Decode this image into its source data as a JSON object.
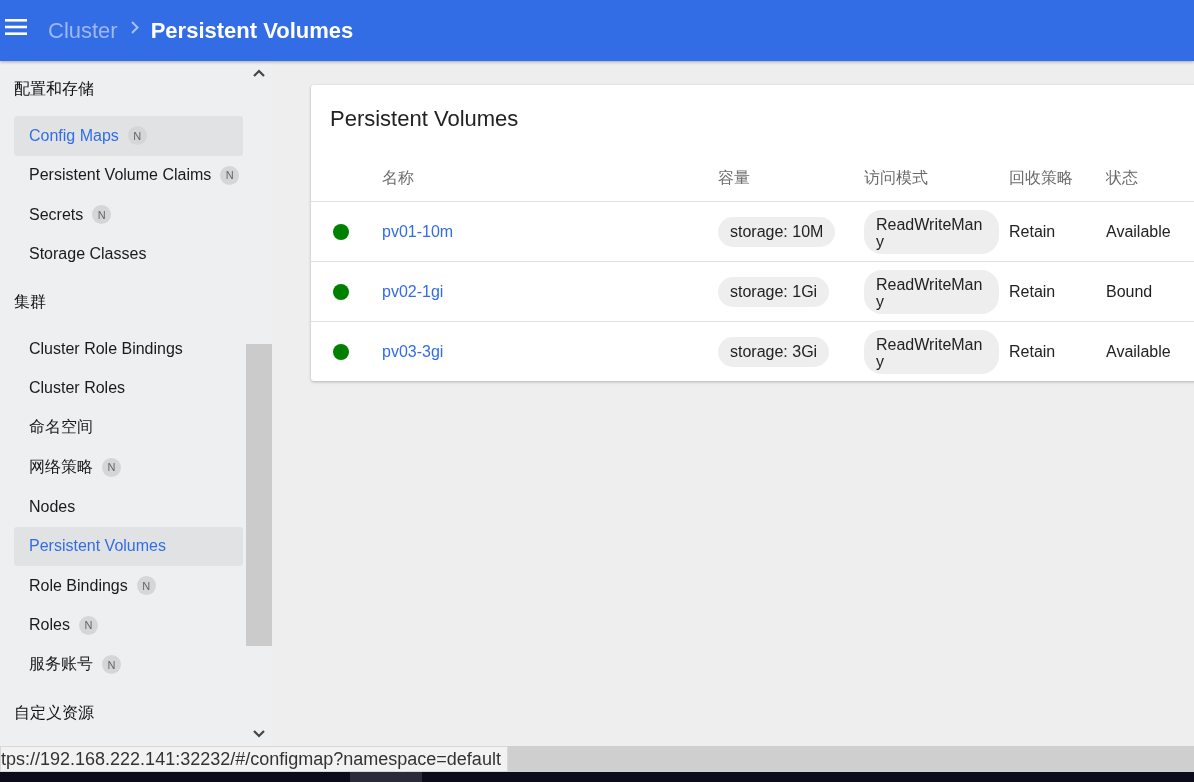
{
  "header": {
    "breadcrumbs": [
      {
        "label": "Cluster",
        "current": false
      },
      {
        "label": "Persistent Volumes",
        "current": true
      }
    ]
  },
  "sidebar": {
    "sections": [
      {
        "title": "配置和存储",
        "items": [
          {
            "label": "Config Maps",
            "badge": "N",
            "selected": true
          },
          {
            "label": "Persistent Volume Claims",
            "badge": "N",
            "selected": false
          },
          {
            "label": "Secrets",
            "badge": "N",
            "selected": false
          },
          {
            "label": "Storage Classes",
            "selected": false
          }
        ]
      },
      {
        "title": "集群",
        "items": [
          {
            "label": "Cluster Role Bindings",
            "selected": false
          },
          {
            "label": "Cluster Roles",
            "selected": false
          },
          {
            "label": "命名空间",
            "selected": false
          },
          {
            "label": "网络策略",
            "badge": "N",
            "selected": false
          },
          {
            "label": "Nodes",
            "selected": false
          },
          {
            "label": "Persistent Volumes",
            "selected": true
          },
          {
            "label": "Role Bindings",
            "badge": "N",
            "selected": false
          },
          {
            "label": "Roles",
            "badge": "N",
            "selected": false
          },
          {
            "label": "服务账号",
            "badge": "N",
            "selected": false
          }
        ]
      },
      {
        "title": "自定义资源"
      }
    ]
  },
  "card": {
    "title": "Persistent Volumes",
    "table": {
      "columns": [
        "名称",
        "容量",
        "访问模式",
        "回收策略",
        "状态"
      ],
      "rows": [
        {
          "color": "#008000",
          "name": "pv01-10m",
          "capacity": "storage: 10M",
          "access_mode": "ReadWriteMany",
          "reclaim_policy": "Retain",
          "status": "Available"
        },
        {
          "color": "#008000",
          "name": "pv02-1gi",
          "capacity": "storage: 1Gi",
          "access_mode": "ReadWriteMany",
          "reclaim_policy": "Retain",
          "status": "Bound"
        },
        {
          "color": "#008000",
          "name": "pv03-3gi",
          "capacity": "storage: 3Gi",
          "access_mode": "ReadWriteMany",
          "reclaim_policy": "Retain",
          "status": "Available"
        }
      ]
    }
  },
  "status_bar": {
    "url": "tps://192.168.222.141:32232/#/configmap?namespace=default"
  }
}
